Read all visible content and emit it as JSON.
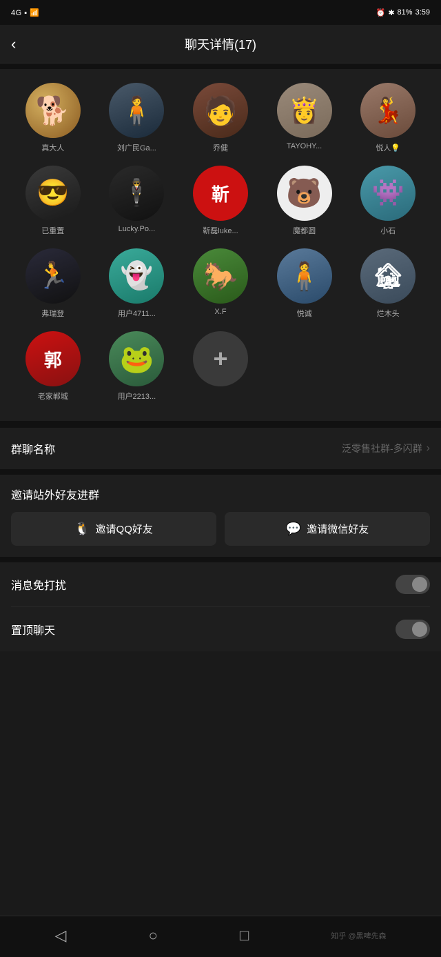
{
  "statusBar": {
    "signal": "4G",
    "time": "3:59",
    "battery": "81%"
  },
  "header": {
    "backLabel": "‹",
    "title": "聊天详情(17)"
  },
  "members": [
    {
      "id": "m1",
      "name": "真大人",
      "avatarType": "dog",
      "emoji": "🐕"
    },
    {
      "id": "m2",
      "name": "刘广民Ga...",
      "avatarType": "person1",
      "emoji": "🧍"
    },
    {
      "id": "m3",
      "name": "乔健",
      "avatarType": "person2",
      "emoji": "🧑"
    },
    {
      "id": "m4",
      "name": "TAYOHY...",
      "avatarType": "lady1",
      "emoji": "👸"
    },
    {
      "id": "m5",
      "name": "悦人💡",
      "avatarType": "lady2",
      "emoji": "💃"
    },
    {
      "id": "m6",
      "name": "已重置",
      "avatarType": "tikguy",
      "emoji": "😎"
    },
    {
      "id": "m7",
      "name": "Lucky.Po...",
      "avatarType": "blackcoat",
      "emoji": "🕴"
    },
    {
      "id": "m8",
      "name": "靳磊luke...",
      "avatarType": "red",
      "text": "靳"
    },
    {
      "id": "m9",
      "name": "魔都圆",
      "avatarType": "bear",
      "emoji": "🐻"
    },
    {
      "id": "m10",
      "name": "小石",
      "avatarType": "alien",
      "emoji": "👾"
    },
    {
      "id": "m11",
      "name": "弗瑞登",
      "avatarType": "runner",
      "emoji": "🏃"
    },
    {
      "id": "m12",
      "name": "用户4711...",
      "avatarType": "monster",
      "emoji": "👻"
    },
    {
      "id": "m13",
      "name": "X.F",
      "avatarType": "horse",
      "emoji": "🐎"
    },
    {
      "id": "m14",
      "name": "悦诚",
      "avatarType": "outdoor",
      "emoji": "🧍"
    },
    {
      "id": "m15",
      "name": "烂木头",
      "avatarType": "statue",
      "emoji": "🏚"
    },
    {
      "id": "m16",
      "name": "老家郸城",
      "avatarType": "redlogo",
      "text": "郭"
    },
    {
      "id": "m17",
      "name": "用户2213...",
      "avatarType": "frog",
      "emoji": "🐸"
    },
    {
      "id": "add",
      "name": "",
      "avatarType": "add",
      "text": "+"
    }
  ],
  "settings": {
    "groupNameLabel": "群聊名称",
    "groupNameValue": "泛零售社群-多闪群",
    "inviteLabel": "邀请站外好友进群",
    "inviteQQ": "邀请QQ好友",
    "inviteWechat": "邀请微信好友",
    "muteLabel": "消息免打扰",
    "muteOn": false,
    "pinLabel": "置顶聊天",
    "pinOn": false
  },
  "bottomNav": {
    "back": "◁",
    "home": "○",
    "recent": "□",
    "watermark": "知乎 @黑啤先森"
  },
  "avatarColors": {
    "dog": "#c8a050",
    "person1": "#3a4a5a",
    "person2": "#7a3a2a",
    "lady1": "#9a8a7a",
    "lady2": "#9a7060",
    "tikguy": "#3a3a3a",
    "blackcoat": "#2a2a2a",
    "red": "#cc2222",
    "bear": "#eeeeee",
    "alien": "#3a8aaa",
    "runner": "#2a2a3a",
    "monster": "#2a9a8a",
    "horse": "#3a7a3a",
    "outdoor": "#4a6a8a",
    "statue": "#5a6a7a",
    "redlogo": "#bb1111",
    "frog": "#4a7a5a",
    "add": "#3a3a3a"
  }
}
